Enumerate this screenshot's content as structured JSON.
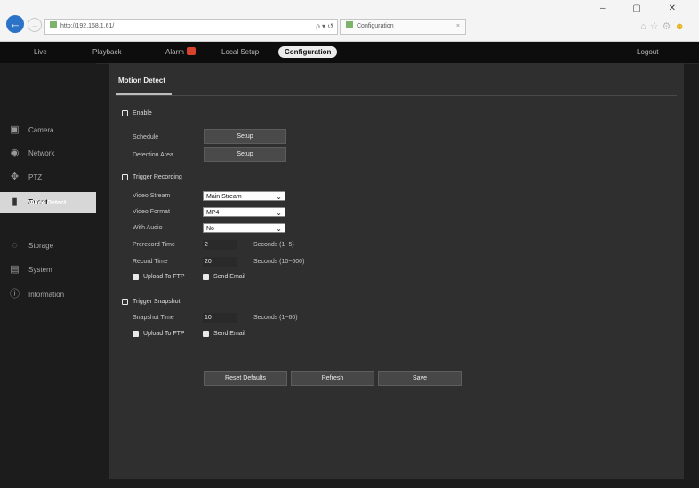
{
  "browser": {
    "url": "http://192.168.1.61/",
    "addr_tools": "ρ ▾ ↺",
    "tab_title": "Configuration",
    "tab_close": "×",
    "window_controls": "–  ▢  ✕"
  },
  "nav": {
    "live": "Live",
    "playback": "Playback",
    "alarm": "Alarm",
    "local_setup": "Local Setup",
    "configuration": "Configuration",
    "logout": "Logout"
  },
  "sidebar": {
    "items": [
      {
        "label": "Camera",
        "icon": "camera-icon"
      },
      {
        "label": "Network",
        "icon": "network-icon"
      },
      {
        "label": "PTZ",
        "icon": "ptz-icon"
      },
      {
        "label": "Event",
        "icon": "event-icon"
      },
      {
        "label": "Storage",
        "icon": "storage-icon"
      },
      {
        "label": "System",
        "icon": "system-icon"
      },
      {
        "label": "Information",
        "icon": "information-icon"
      }
    ],
    "sub_item": "Video Detect"
  },
  "panel": {
    "title": "Motion Detect",
    "enable": {
      "label": "Enable",
      "checked": true
    },
    "schedule": {
      "label": "Schedule",
      "button": "Setup"
    },
    "detection_area": {
      "label": "Detection Area",
      "button": "Setup"
    },
    "trigger_recording": {
      "label": "Trigger Recording",
      "checked": true
    },
    "video_stream": {
      "label": "Video Stream",
      "value": "Main Stream"
    },
    "video_format": {
      "label": "Video Format",
      "value": "MP4"
    },
    "with_audio": {
      "label": "With Audio",
      "value": "No"
    },
    "prerecord_time": {
      "label": "Prerecord Time",
      "value": "2",
      "hint": "Seconds (1~5)"
    },
    "record_time": {
      "label": "Record Time",
      "value": "20",
      "hint": "Seconds (10~600)"
    },
    "rec_upload_ftp": {
      "label": "Upload To FTP",
      "checked": false
    },
    "rec_send_email": {
      "label": "Send Email",
      "checked": false
    },
    "trigger_snapshot": {
      "label": "Trigger Snapshot",
      "checked": true
    },
    "snapshot_time": {
      "label": "Snapshot Time",
      "value": "10",
      "hint": "Seconds (1~60)"
    },
    "snap_upload_ftp": {
      "label": "Upload To FTP",
      "checked": false
    },
    "snap_send_email": {
      "label": "Send Email",
      "checked": false
    },
    "buttons": {
      "reset": "Reset Defaults",
      "refresh": "Refresh",
      "save": "Save"
    }
  },
  "colors": {
    "app_bg": "#1c1c1c",
    "panel_bg": "#2f2f2f",
    "topnav_bg": "#0d0d0d",
    "active_tab": "#ececec",
    "alarm_badge": "#d7432c",
    "browser_back": "#2b73c6"
  }
}
